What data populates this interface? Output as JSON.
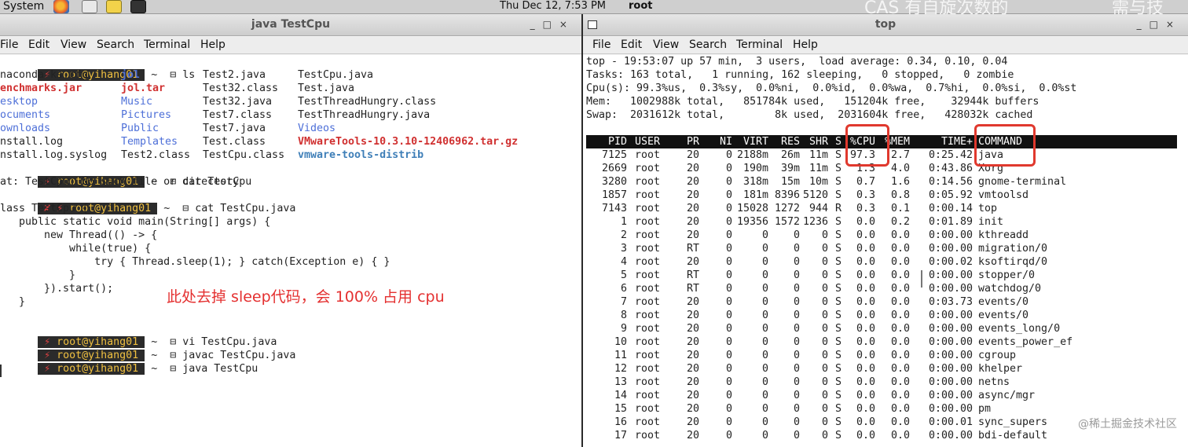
{
  "panel": {
    "system_label": "System",
    "clock": "Thu Dec 12,  7:53 PM",
    "user": "root",
    "overlay_text_1": "CAS 有自旋次数的",
    "overlay_text_2": "需与技"
  },
  "left_window": {
    "title": "java TestCpu",
    "menu": [
      "File",
      "Edit",
      "View",
      "Search",
      "Terminal",
      "Help"
    ],
    "prompt_user": "root@yihang01",
    "commands": {
      "ls": "ls",
      "cat1": "cat TestCpu",
      "cat2": "cat TestCpu.java",
      "vi": "vi TestCpu.java",
      "javac": "javac TestCpu.java",
      "run": "java TestCpu"
    },
    "ls_rows": [
      [
        "naconda-ks.cfg",
        "jol",
        "Test2.java",
        "TestCpu.java"
      ],
      [
        "enchmarks.jar",
        "jol.tar",
        "Test32.class",
        "Test.java"
      ],
      [
        "esktop",
        "Music",
        "Test32.java",
        "TestThreadHungry.class"
      ],
      [
        "ocuments",
        "Pictures",
        "Test7.class",
        "TestThreadHungry.java"
      ],
      [
        "ownloads",
        "Public",
        "Test7.java",
        "Videos"
      ],
      [
        "nstall.log",
        "Templates",
        "Test.class",
        "VMwareTools-10.3.10-12406962.tar.gz"
      ],
      [
        "nstall.log.syslog",
        "Test2.class",
        "TestCpu.class",
        "vmware-tools-distrib"
      ]
    ],
    "cat_error": "at: TestCpu: No such file or directory",
    "code": [
      "lass TestCpu {",
      "   public static void main(String[] args) {",
      "       new Thread(() -> {",
      "           while(true) {",
      "               try { Thread.sleep(1); } catch(Exception e) { }",
      "           }",
      "       }).start();",
      "   }"
    ],
    "annotation": "此处去掉 sleep代码，会 100% 占用 cpu"
  },
  "right_window": {
    "title": "top",
    "menu": [
      "File",
      "Edit",
      "View",
      "Search",
      "Terminal",
      "Help"
    ],
    "summary": [
      "top - 19:53:07 up 57 min,  3 users,  load average: 0.34, 0.10, 0.04",
      "Tasks: 163 total,   1 running, 162 sleeping,   0 stopped,   0 zombie",
      "Cpu(s): 99.3%us,  0.3%sy,  0.0%ni,  0.0%id,  0.0%wa,  0.7%hi,  0.0%si,  0.0%st",
      "Mem:   1002988k total,   851784k used,   151204k free,    32944k buffers",
      "Swap:  2031612k total,        8k used,  2031604k free,   428032k cached"
    ],
    "columns": [
      "PID",
      "USER",
      "PR",
      "NI",
      "VIRT",
      "RES",
      "SHR",
      "S",
      "%CPU",
      "%MEM",
      "TIME+",
      "COMMAND"
    ],
    "processes": [
      [
        "7125",
        "root",
        "20",
        "0",
        "2188m",
        "26m",
        "11m",
        "S",
        "97.3",
        "2.7",
        "0:25.42",
        "java"
      ],
      [
        "2669",
        "root",
        "20",
        "0",
        "190m",
        "39m",
        "11m",
        "S",
        "1.3",
        "4.0",
        "0:43.86",
        "Xorg"
      ],
      [
        "3280",
        "root",
        "20",
        "0",
        "318m",
        "15m",
        "10m",
        "S",
        "0.7",
        "1.6",
        "0:14.56",
        "gnome-terminal"
      ],
      [
        "1857",
        "root",
        "20",
        "0",
        "181m",
        "8396",
        "5120",
        "S",
        "0.3",
        "0.8",
        "0:05.92",
        "vmtoolsd"
      ],
      [
        "7143",
        "root",
        "20",
        "0",
        "15028",
        "1272",
        "944",
        "R",
        "0.3",
        "0.1",
        "0:00.14",
        "top"
      ],
      [
        "1",
        "root",
        "20",
        "0",
        "19356",
        "1572",
        "1236",
        "S",
        "0.0",
        "0.2",
        "0:01.89",
        "init"
      ],
      [
        "2",
        "root",
        "20",
        "0",
        "0",
        "0",
        "0",
        "S",
        "0.0",
        "0.0",
        "0:00.00",
        "kthreadd"
      ],
      [
        "3",
        "root",
        "RT",
        "0",
        "0",
        "0",
        "0",
        "S",
        "0.0",
        "0.0",
        "0:00.00",
        "migration/0"
      ],
      [
        "4",
        "root",
        "20",
        "0",
        "0",
        "0",
        "0",
        "S",
        "0.0",
        "0.0",
        "0:00.02",
        "ksoftirqd/0"
      ],
      [
        "5",
        "root",
        "RT",
        "0",
        "0",
        "0",
        "0",
        "S",
        "0.0",
        "0.0",
        "0:00.00",
        "stopper/0"
      ],
      [
        "6",
        "root",
        "RT",
        "0",
        "0",
        "0",
        "0",
        "S",
        "0.0",
        "0.0",
        "0:00.00",
        "watchdog/0"
      ],
      [
        "7",
        "root",
        "20",
        "0",
        "0",
        "0",
        "0",
        "S",
        "0.0",
        "0.0",
        "0:03.73",
        "events/0"
      ],
      [
        "8",
        "root",
        "20",
        "0",
        "0",
        "0",
        "0",
        "S",
        "0.0",
        "0.0",
        "0:00.00",
        "events/0"
      ],
      [
        "9",
        "root",
        "20",
        "0",
        "0",
        "0",
        "0",
        "S",
        "0.0",
        "0.0",
        "0:00.00",
        "events_long/0"
      ],
      [
        "10",
        "root",
        "20",
        "0",
        "0",
        "0",
        "0",
        "S",
        "0.0",
        "0.0",
        "0:00.00",
        "events_power_ef"
      ],
      [
        "11",
        "root",
        "20",
        "0",
        "0",
        "0",
        "0",
        "S",
        "0.0",
        "0.0",
        "0:00.00",
        "cgroup"
      ],
      [
        "12",
        "root",
        "20",
        "0",
        "0",
        "0",
        "0",
        "S",
        "0.0",
        "0.0",
        "0:00.00",
        "khelper"
      ],
      [
        "13",
        "root",
        "20",
        "0",
        "0",
        "0",
        "0",
        "S",
        "0.0",
        "0.0",
        "0:00.00",
        "netns"
      ],
      [
        "14",
        "root",
        "20",
        "0",
        "0",
        "0",
        "0",
        "S",
        "0.0",
        "0.0",
        "0:00.00",
        "async/mgr"
      ],
      [
        "15",
        "root",
        "20",
        "0",
        "0",
        "0",
        "0",
        "S",
        "0.0",
        "0.0",
        "0:00.00",
        "pm"
      ],
      [
        "16",
        "root",
        "20",
        "0",
        "0",
        "0",
        "0",
        "S",
        "0.0",
        "0.0",
        "0:00.01",
        "sync_supers"
      ],
      [
        "17",
        "root",
        "20",
        "0",
        "0",
        "0",
        "0",
        "S",
        "0.0",
        "0.0",
        "0:00.00",
        "bdi-default"
      ]
    ]
  },
  "watermark": "@稀土掘金技术社区",
  "colors": {
    "annotation_red": "#e43030",
    "highlight_box": "#e0392e",
    "dir_blue": "#4d6fd8",
    "archive_red": "#d03030"
  }
}
